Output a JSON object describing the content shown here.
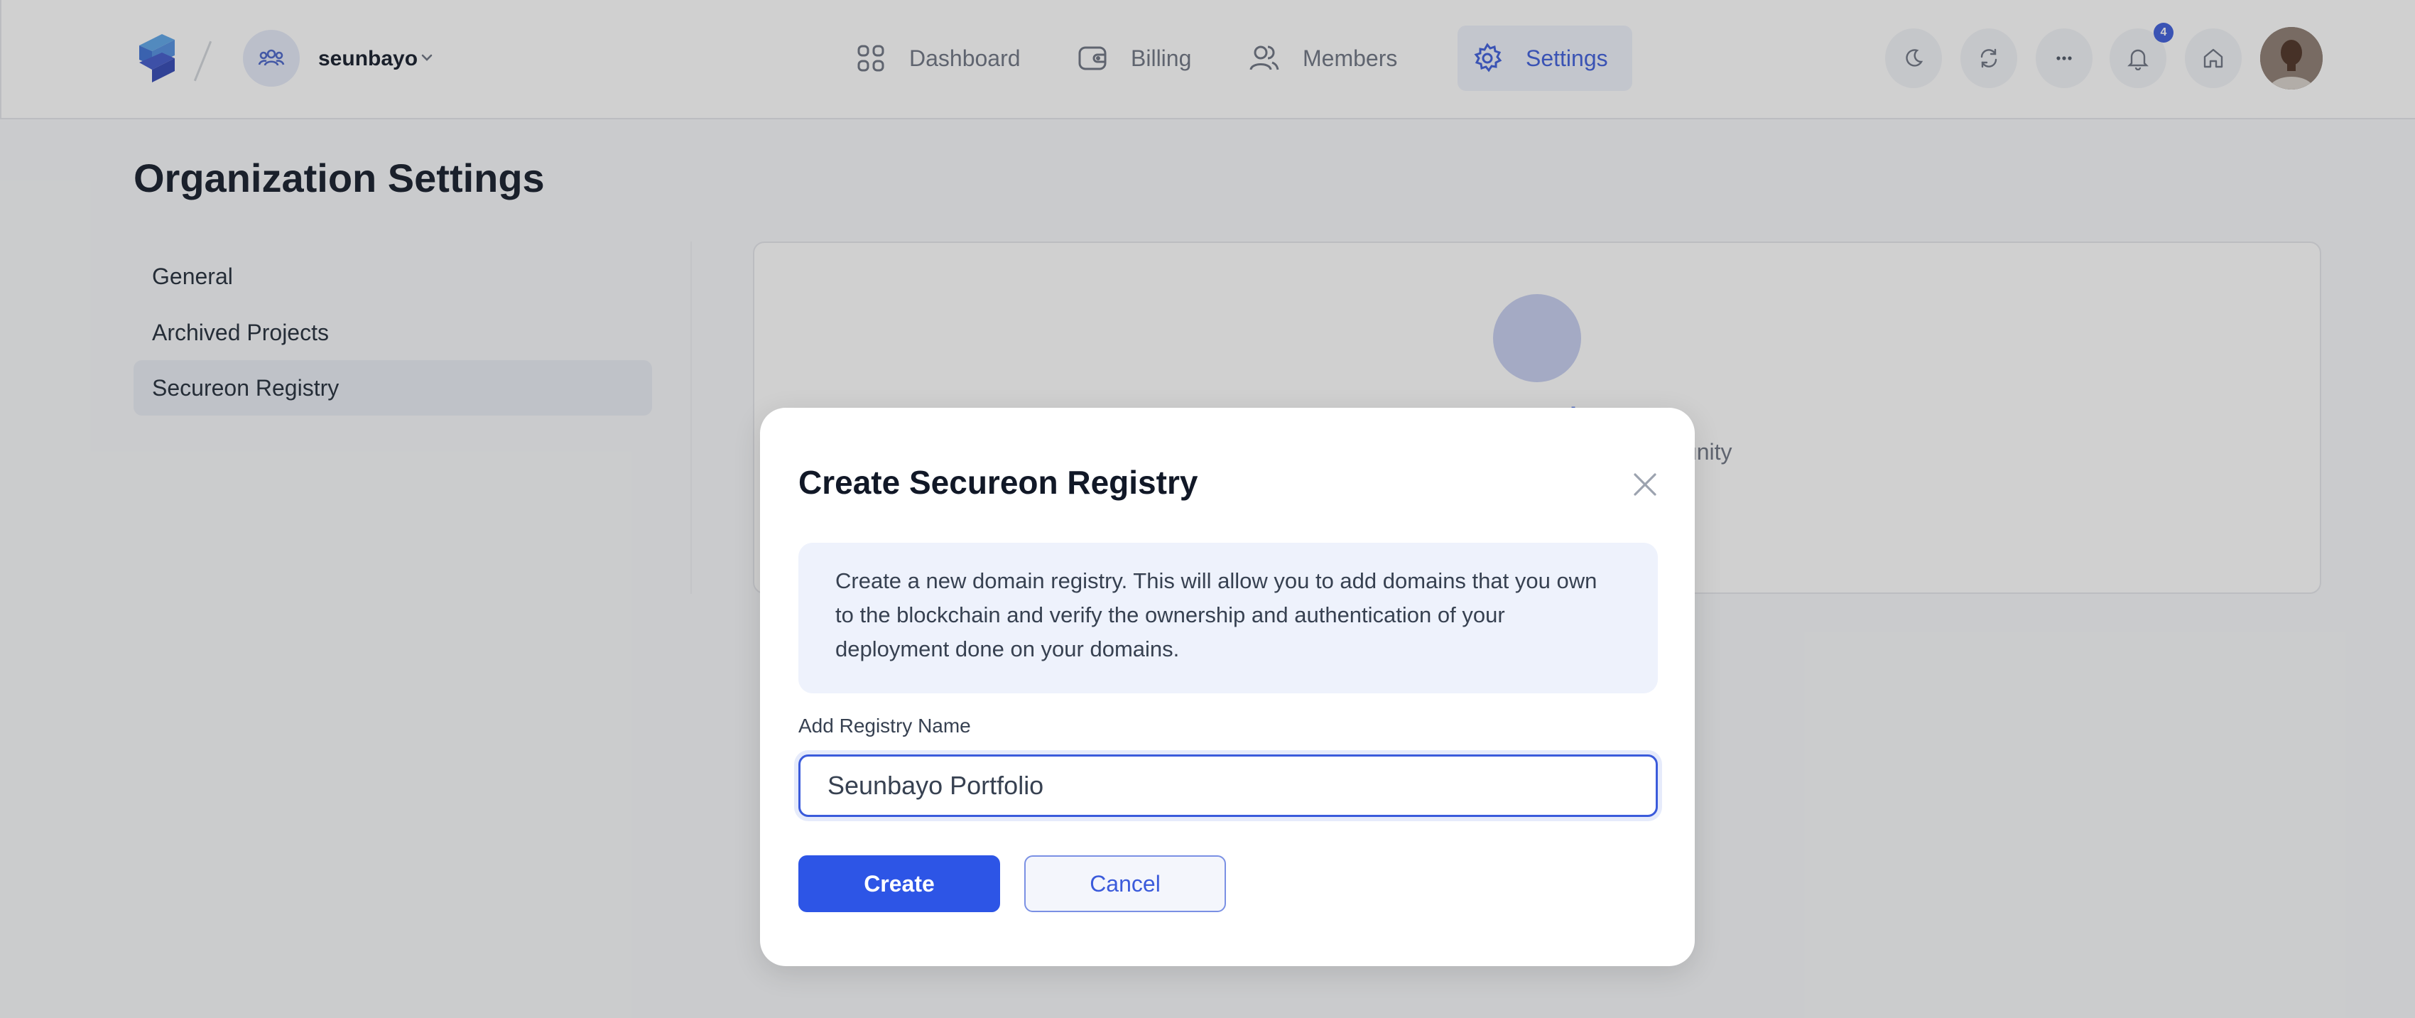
{
  "header": {
    "org_name": "seunbayo",
    "nav": [
      {
        "label": "Dashboard",
        "icon": "grid-icon",
        "active": false
      },
      {
        "label": "Billing",
        "icon": "wallet-icon",
        "active": false
      },
      {
        "label": "Members",
        "icon": "users-icon",
        "active": false
      },
      {
        "label": "Settings",
        "icon": "gear-icon",
        "active": true
      }
    ],
    "notification_count": "4",
    "icons": [
      "moon-icon",
      "refresh-icon",
      "more-icon",
      "bell-icon",
      "home-icon"
    ]
  },
  "page": {
    "title": "Organization Settings",
    "sidebar": [
      {
        "label": "General",
        "active": false
      },
      {
        "label": "Archived Projects",
        "active": false
      },
      {
        "label": "Secureon Registry",
        "active": true
      }
    ],
    "panel": {
      "title_partial": "s project",
      "subtitle_partial": "it with your community"
    }
  },
  "modal": {
    "title": "Create Secureon Registry",
    "info": "Create a new domain registry. This will allow you to add domains that you own to the blockchain and verify the ownership and authentication of your deployment done on your domains.",
    "field_label": "Add Registry Name",
    "field_value": "Seunbayo Portfolio",
    "create_label": "Create",
    "cancel_label": "Cancel"
  },
  "colors": {
    "accent": "#3b5bdb",
    "primary_button": "#2d55e6",
    "info_bg": "#eef2fc"
  }
}
